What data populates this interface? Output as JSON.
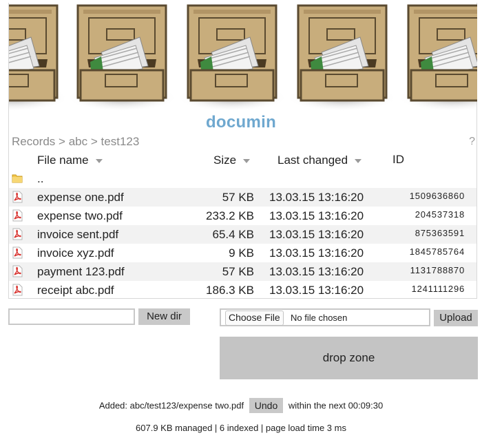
{
  "app": {
    "brand": "documin"
  },
  "breadcrumb": {
    "items": [
      "Records",
      "abc",
      "test123"
    ],
    "separator": ">"
  },
  "help_label": "?",
  "table": {
    "columns": {
      "name": "File name",
      "size": "Size",
      "changed": "Last changed",
      "id": "ID"
    },
    "parent_dir": "..",
    "rows": [
      {
        "name": "expense one.pdf",
        "size": "57 KB",
        "changed": "13.03.15 13:16:20",
        "id": "1509636860",
        "icon": "pdf-icon"
      },
      {
        "name": "expense two.pdf",
        "size": "233.2 KB",
        "changed": "13.03.15 13:16:20",
        "id": "204537318",
        "icon": "pdf-icon"
      },
      {
        "name": "invoice sent.pdf",
        "size": "65.4 KB",
        "changed": "13.03.15 13:16:20",
        "id": "875363591",
        "icon": "pdf-icon"
      },
      {
        "name": "invoice xyz.pdf",
        "size": "9 KB",
        "changed": "13.03.15 13:16:20",
        "id": "1845785764",
        "icon": "pdf-icon"
      },
      {
        "name": "payment 123.pdf",
        "size": "57 KB",
        "changed": "13.03.15 13:16:20",
        "id": "1131788870",
        "icon": "pdf-icon"
      },
      {
        "name": "receipt abc.pdf",
        "size": "186.3 KB",
        "changed": "13.03.15 13:16:20",
        "id": "1241111296",
        "icon": "pdf-icon"
      }
    ]
  },
  "actions": {
    "new_dir_value": "",
    "new_dir_label": "New dir",
    "choose_file_label": "Choose File",
    "no_file_label": "No file chosen",
    "upload_label": "Upload",
    "drop_zone_label": "drop zone"
  },
  "notice": {
    "prefix": "Added: abc/test123/expense two.pdf",
    "undo_label": "Undo",
    "suffix": "within the next 00:09:30"
  },
  "footer": "607.9 KB managed | 6 indexed | page load time 3 ms",
  "colors": {
    "brand": "#6fa8cf",
    "cabinet": "#c8ad7c",
    "button": "#c9c9c9",
    "row_alt": "#f2f2f2",
    "pdf_red": "#d8322e",
    "folder": "#f3c64b"
  }
}
